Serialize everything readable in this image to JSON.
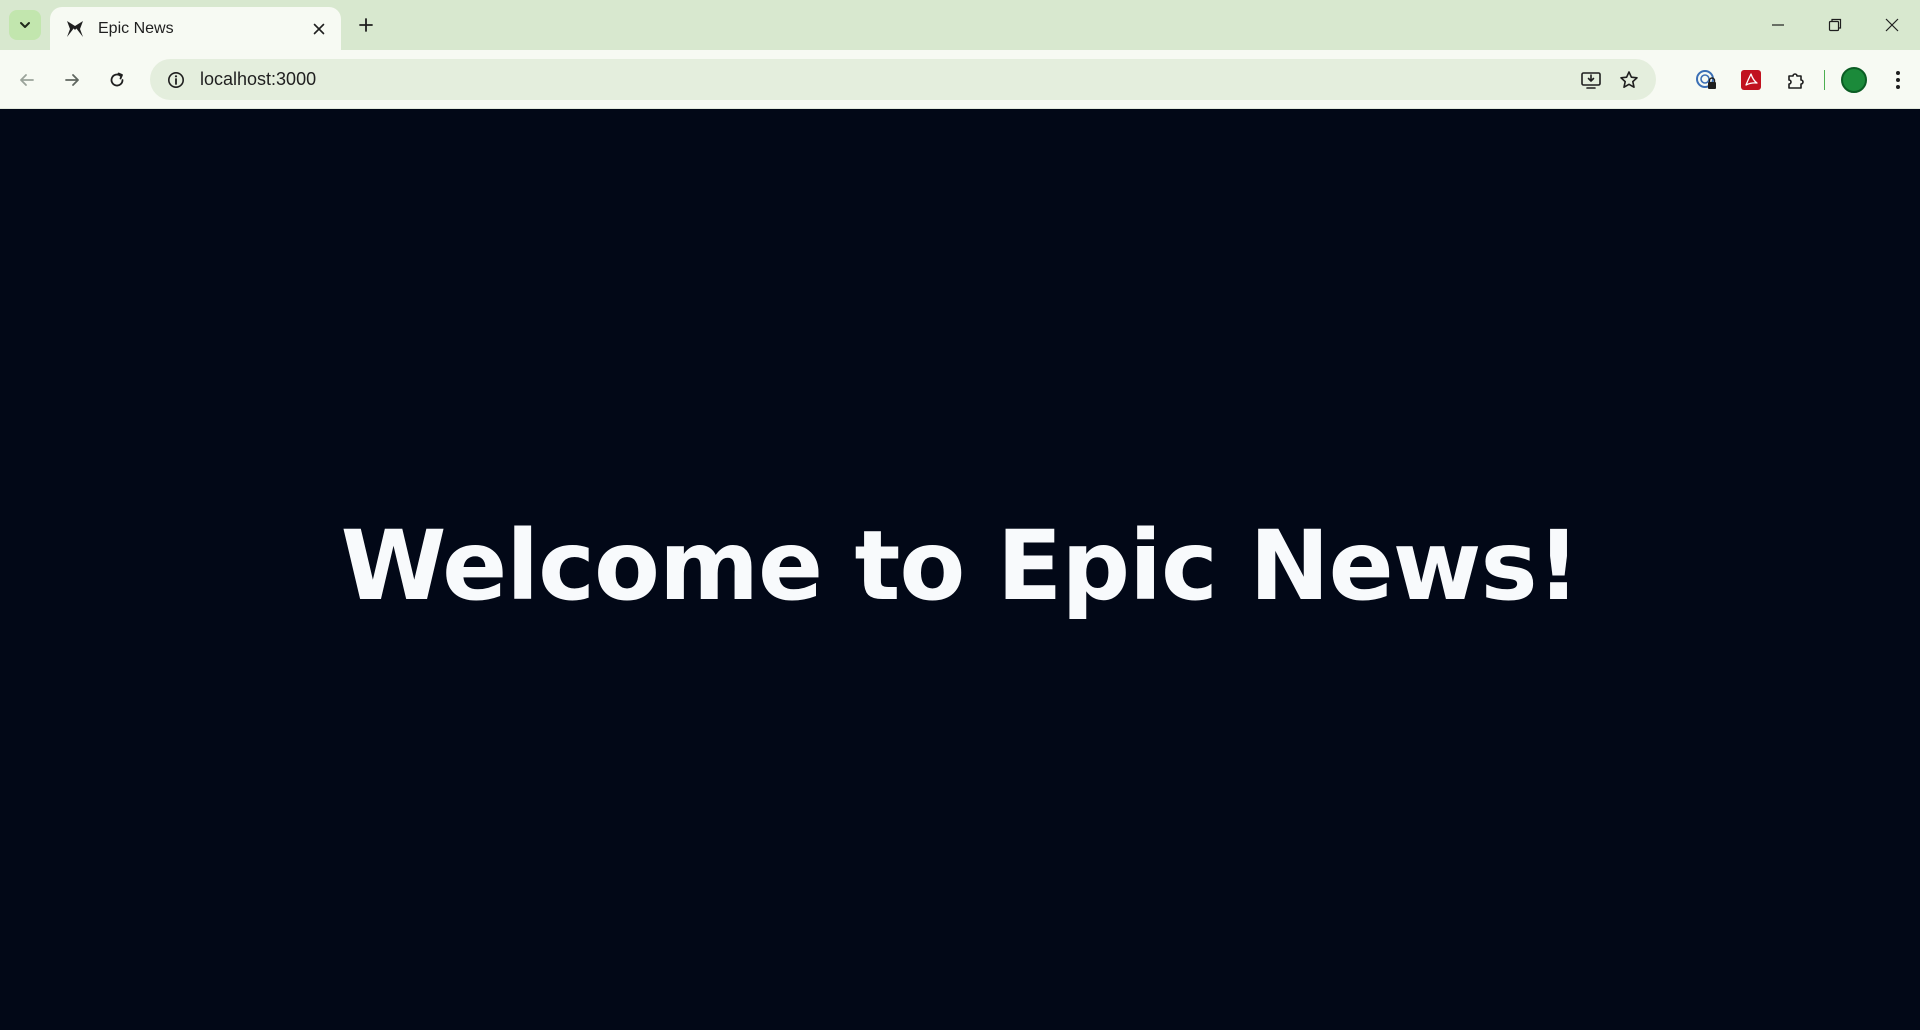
{
  "browser": {
    "tab": {
      "title": "Epic News",
      "favicon": "epic-news-favicon"
    },
    "address_bar": {
      "url": "localhost:3000",
      "site_info_icon": "info-icon"
    },
    "toolbar_icons": [
      "back-arrow-icon",
      "forward-arrow-icon",
      "reload-icon",
      "install-app-icon",
      "bookmark-star-icon"
    ],
    "extensions": [
      "password-manager-icon",
      "pdf-icon",
      "puzzle-extensions-icon"
    ],
    "profile_color": "#1b8a3a",
    "theme": {
      "tabstrip_bg": "#d8e8cf",
      "toolbar_bg": "#f7faf3",
      "omnibox_bg": "#e4eedd"
    }
  },
  "page": {
    "heading": "Welcome to Epic News!",
    "background_color": "#020817",
    "text_color": "#f8fafc"
  }
}
